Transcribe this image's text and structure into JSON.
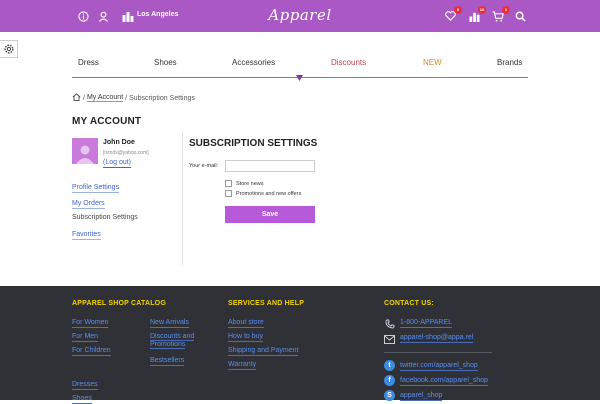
{
  "header": {
    "city": "Los Angeles",
    "logo": "Apparel",
    "wishlist_count": "0",
    "compare_count": "10",
    "cart_count": "1"
  },
  "nav": {
    "items": [
      "Dress",
      "Shoes",
      "Accessories",
      "Discounts",
      "NEW",
      "Brands"
    ]
  },
  "breadcrumb": {
    "account": "My Account",
    "separator": "/",
    "current": "Subscription Settings"
  },
  "account": {
    "title": "MY ACCOUNT",
    "name": "John Doe",
    "email": "[nznds@yahoo.com]",
    "logout": "(Log out)",
    "menu": [
      "Profile Settings",
      "My Orders",
      "Subscription Settings",
      "Favorites"
    ]
  },
  "subscription": {
    "title": "SUBSCRIPTION SETTINGS",
    "email_label": "Your e-mail:",
    "email_value": "",
    "option_store_news": "Store news",
    "option_promotions": "Promotions and new offers",
    "save": "Save"
  },
  "footer": {
    "catalog_title": "APPAREL SHOP CATALOG",
    "catalog_col1": [
      "For Women",
      "For Men",
      "For Children"
    ],
    "catalog_col2": [
      "New Arrivals",
      "Discounts and Promotions",
      "Bestsellers"
    ],
    "catalog_extra": [
      "Dresses",
      "Shoes"
    ],
    "services_title": "SERVICES AND HELP",
    "services": [
      "About store",
      "How to buy",
      "Shipping and Payment",
      "Warranty"
    ],
    "contact_title": "CONTACT US:",
    "phone": "1-800-APPAREL",
    "email": "apparel-shop@appa.rel",
    "twitter": "twitter.com/apparel_shop",
    "facebook": "facebook.com/apparel_shop",
    "skype": "apparel_shop"
  },
  "colors": {
    "brand": "#a958c6",
    "save_button": "#b65ad9",
    "footer_bg": "#2f3136",
    "footer_heading": "#f2d400",
    "link": "#3e64c9"
  }
}
